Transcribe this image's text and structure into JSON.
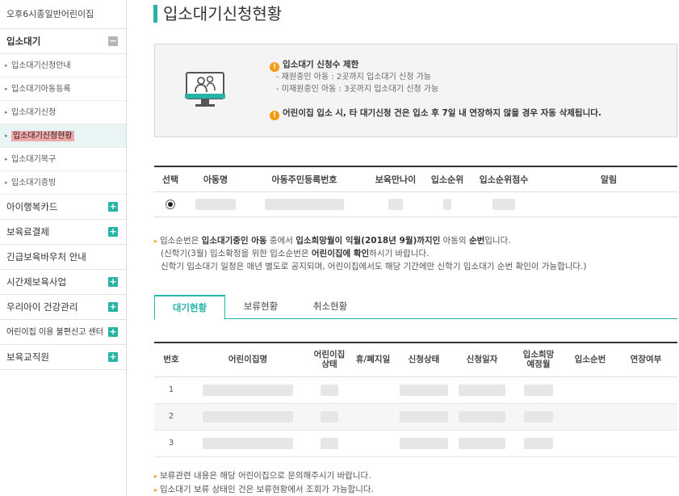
{
  "sidebar": {
    "org_name": "오후6시종일반어린이집",
    "section_main": "입소대기",
    "sub_items": [
      {
        "label": "입소대기신청안내"
      },
      {
        "label": "입소대기아동등록"
      },
      {
        "label": "입소대기신청"
      },
      {
        "label": "입소대기신청현황"
      },
      {
        "label": "입소대기복구"
      },
      {
        "label": "입소대기증빙"
      }
    ],
    "sections": [
      {
        "label": "아이행복카드"
      },
      {
        "label": "보육료결제"
      },
      {
        "label": "긴급보육바우처 안내"
      },
      {
        "label": "시간제보육사업"
      },
      {
        "label": "우리아이 건강관리"
      },
      {
        "label": "어린이집 이용 불편신고 센터"
      },
      {
        "label": "보육교직원"
      }
    ]
  },
  "page": {
    "title": "입소대기신청현황"
  },
  "notice": {
    "heading1": "입소대기 신청수 제한",
    "line1": "- 재원중인 아동 : 2곳까지 입소대기 신청 가능",
    "line2": "- 미재원중인 아동 : 3곳까지 입소대기 신청 가능",
    "heading2": "어린이집 입소 시, 타 대기신청 건은 입소 후 7일 내 연장하지 않을 경우 자동 삭제됩니다."
  },
  "child_table": {
    "headers": [
      "선택",
      "아동명",
      "아동주민등록번호",
      "보육만나이",
      "입소순위",
      "입소순위점수",
      "알림"
    ]
  },
  "info": {
    "l1_a": "입소순번은 ",
    "l1_b": "입소대기중인 아동",
    "l1_c": " 중에서 ",
    "l1_d": "입소희망월이 익월(2018년 9월)까지인",
    "l1_e": " 아동의 ",
    "l1_f": "순번",
    "l1_g": "입니다.",
    "l2_a": "(신학기(3월) 입소확정을 위한 입소순번은 ",
    "l2_b": "어린이집에 확인",
    "l2_c": "하시기 바랍니다.",
    "l3": "신학기 입소대기 일정은 매년 별도로 공지되며, 어린이집에서도 해당 기간에만 신학기 입소대기 순번 확인이 가능합니다.)"
  },
  "tabs": [
    {
      "label": "대기현황"
    },
    {
      "label": "보류현황"
    },
    {
      "label": "취소현황"
    }
  ],
  "status_table": {
    "headers": [
      "번호",
      "어린이집명",
      "어린이집\n상태",
      "휴/폐지일",
      "신청상태",
      "신청일자",
      "입소희망\n예정월",
      "입소순번",
      "연장여부"
    ],
    "rows": [
      {
        "no": "1"
      },
      {
        "no": "2"
      },
      {
        "no": "3"
      }
    ]
  },
  "bottom": {
    "line1": "보류관련 내용은 해당 어린이집으로 문의해주시기 바랍니다.",
    "line2": "입소대기 보류 상태인 건은 보류현황에서 조회가 가능합니다."
  },
  "colors": {
    "accent": "#27b3a5",
    "warning": "#f39c12",
    "active_highlight": "#f0a8a8"
  }
}
